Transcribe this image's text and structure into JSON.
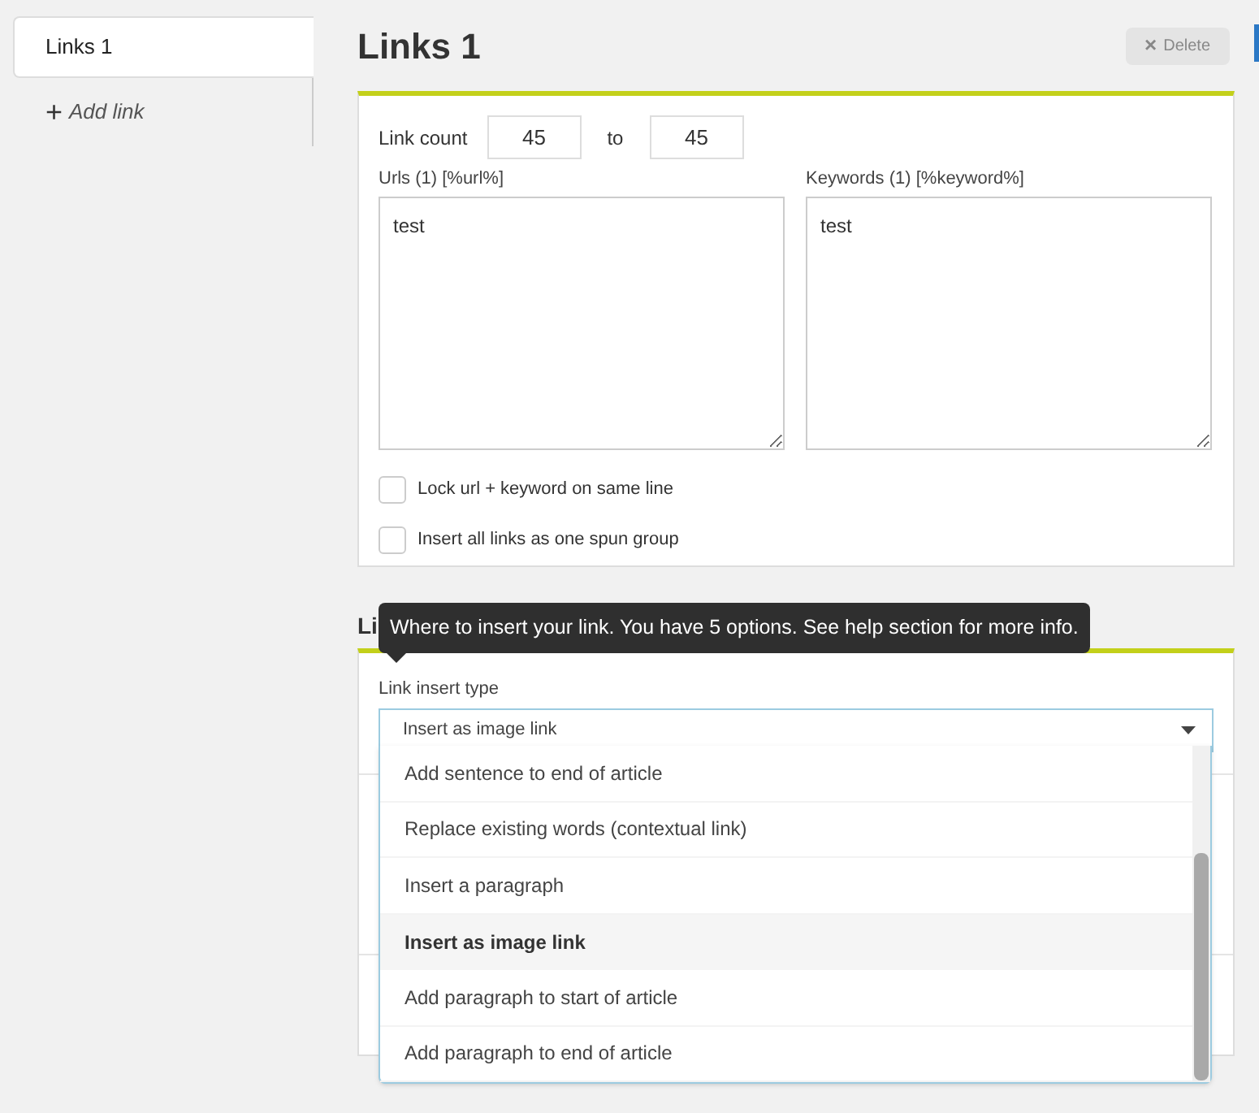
{
  "sidebar": {
    "tabs": [
      {
        "label": "Links 1",
        "selected": true
      }
    ],
    "add_link": {
      "icon": "+",
      "label": "Add link"
    }
  },
  "title": "Links 1",
  "delete_button": {
    "icon": "×",
    "label": "Delete"
  },
  "link_card": {
    "count_label": "Link count",
    "count_from": "45",
    "to_label": "to",
    "count_to": "45",
    "urls": {
      "label": "Urls (1) [%url%]",
      "value": "test"
    },
    "keywords": {
      "label": "Keywords (1) [%keyword%]",
      "value": "test"
    },
    "options": [
      {
        "label": "Lock url + keyword on same line",
        "checked": false
      },
      {
        "label": "Insert all links as one spun group",
        "checked": false
      }
    ]
  },
  "insert_section": {
    "heading": "Li",
    "tooltip": "Where to insert your link. You have 5 options. See help section for more info.",
    "select_label": "Link insert type",
    "select_value": "Insert as image link",
    "expanded": true,
    "options": [
      {
        "label": "Add sentence to end of article",
        "selected": false
      },
      {
        "label": "Replace existing words (contextual link)",
        "selected": false
      },
      {
        "label": "Insert a paragraph",
        "selected": false
      },
      {
        "label": "Insert as image link",
        "selected": true
      },
      {
        "label": "Add paragraph to start of article",
        "selected": false
      },
      {
        "label": "Add paragraph to end of article",
        "selected": false
      }
    ]
  }
}
